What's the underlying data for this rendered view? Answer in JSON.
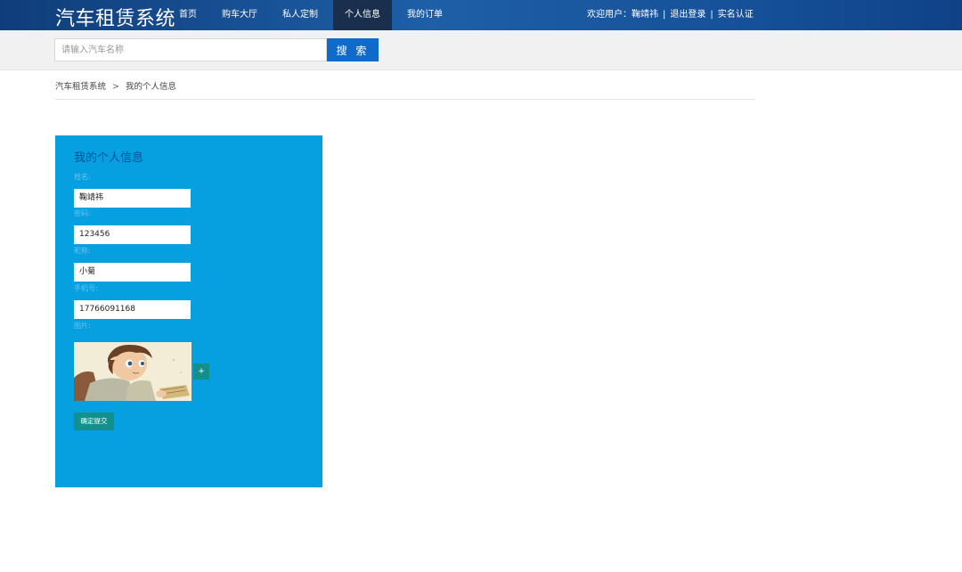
{
  "header": {
    "logo": "汽车租赁系统",
    "nav": [
      {
        "label": "首页",
        "active": false
      },
      {
        "label": "购车大厅",
        "active": false
      },
      {
        "label": "私人定制",
        "active": false
      },
      {
        "label": "个人信息",
        "active": true
      },
      {
        "label": "我的订单",
        "active": false
      }
    ],
    "welcome": "欢迎用户：鞠靖祎",
    "separator": "|",
    "logout": "退出登录",
    "verify": "实名认证"
  },
  "search": {
    "placeholder": "请输入汽车名称",
    "button_label": "搜 索"
  },
  "breadcrumb": {
    "home": "汽车租赁系统",
    "arrow": ">",
    "current": "我的个人信息"
  },
  "profile": {
    "title": "我的个人信息",
    "fields": [
      {
        "label": "姓名:",
        "value": "鞠靖祎"
      },
      {
        "label": "密码:",
        "value": "123456"
      },
      {
        "label": "昵称:",
        "value": "小菊"
      },
      {
        "label": "手机号:",
        "value": "17766091168"
      }
    ],
    "photo_label": "图片:",
    "upload_label": "+",
    "submit_label": "确定提交"
  },
  "colors": {
    "header_dark": "#0f3d7a",
    "nav_active": "#1a2f4e",
    "search_button": "#0e6bc9",
    "panel_bg": "#069fe0",
    "panel_title": "#0a4f9a",
    "teal_button": "#138f8c"
  }
}
